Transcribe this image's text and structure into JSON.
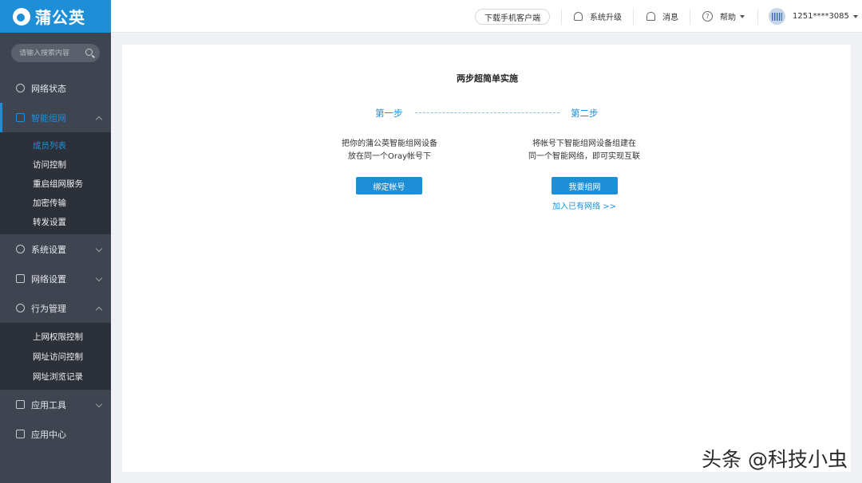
{
  "brand": {
    "name": "蒲公英"
  },
  "search": {
    "placeholder": "请输入搜索内容"
  },
  "sidebar": {
    "items": [
      {
        "label": "网络状态"
      },
      {
        "label": "智能组网",
        "sub": [
          "成员列表",
          "访问控制",
          "重启组网服务",
          "加密传输",
          "转发设置"
        ]
      },
      {
        "label": "系统设置"
      },
      {
        "label": "网络设置"
      },
      {
        "label": "行为管理",
        "sub": [
          "上网权限控制",
          "网址访问控制",
          "网址浏览记录"
        ]
      },
      {
        "label": "应用工具"
      },
      {
        "label": "应用中心"
      }
    ]
  },
  "topbar": {
    "download": "下载手机客户端",
    "upgrade": "系统升级",
    "messages": "消息",
    "help": "帮助",
    "account": "1251****3085"
  },
  "main": {
    "title": "两步超简单实施",
    "step1": {
      "label": "第一步",
      "line1": "把你的蒲公英智能组网设备",
      "line2": "放在同一个Oray帐号下",
      "button": "绑定帐号"
    },
    "step2": {
      "label": "第二步",
      "line1": "将帐号下智能组网设备组建在",
      "line2": "同一个智能网络，即可实现互联",
      "button": "我要组网",
      "link": "加入已有网络 >>"
    }
  },
  "watermark": "头条 @科技小虫",
  "colors": {
    "accent": "#1e8fd7",
    "sidebar": "#3e4450",
    "submenu": "#2c3139"
  }
}
